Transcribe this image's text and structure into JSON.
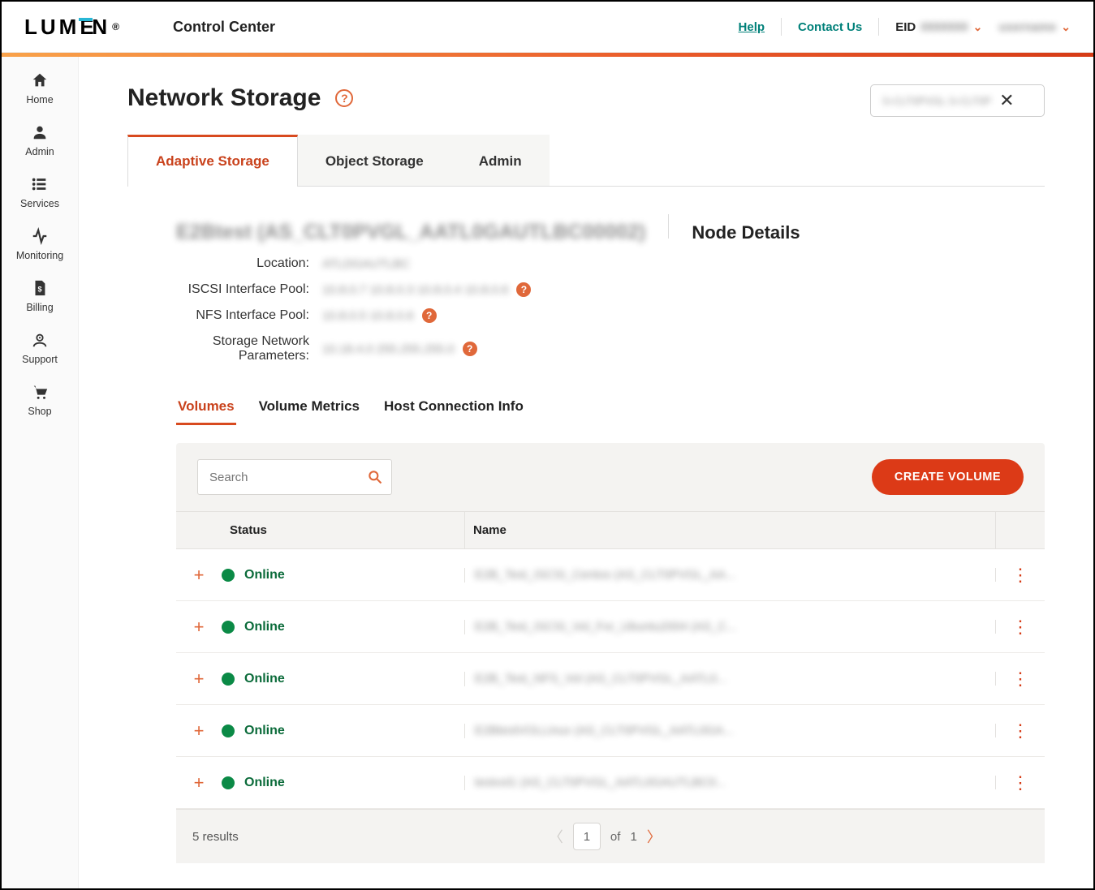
{
  "header": {
    "brand": "LUMEN",
    "app": "Control Center",
    "help": "Help",
    "contact": "Contact Us",
    "eid_label": "EID",
    "eid_value": "0000000",
    "user": "username"
  },
  "sidebar": {
    "items": [
      {
        "label": "Home"
      },
      {
        "label": "Admin"
      },
      {
        "label": "Services"
      },
      {
        "label": "Monitoring"
      },
      {
        "label": "Billing"
      },
      {
        "label": "Support"
      },
      {
        "label": "Shop"
      }
    ]
  },
  "page": {
    "title": "Network Storage",
    "chip_value": "S-CLT0PVGL S-CLT0P",
    "tabs": [
      {
        "label": "Adaptive Storage",
        "active": true
      },
      {
        "label": "Object Storage",
        "active": false
      },
      {
        "label": "Admin",
        "active": false
      }
    ]
  },
  "node": {
    "heading": "E2Btest (AS_CLT0PVGL_AATL0GAUTLBC00002)",
    "title": "Node Details",
    "rows": [
      {
        "label": "Location:",
        "value": "ATLDGAUTLBC",
        "help": false
      },
      {
        "label": "ISCSI Interface Pool:",
        "value": "10.8.0.7 10.8.0.3 10.8.0.4 10.8.0.6",
        "help": true
      },
      {
        "label": "NFS Interface Pool:",
        "value": "10.8.0.5 10.8.0.6",
        "help": true
      },
      {
        "label": "Storage Network Parameters:",
        "value": "10.18.4.0 255.255.255.0",
        "help": true
      }
    ]
  },
  "subtabs": [
    {
      "label": "Volumes",
      "active": true
    },
    {
      "label": "Volume Metrics",
      "active": false
    },
    {
      "label": "Host Connection Info",
      "active": false
    }
  ],
  "table": {
    "search_placeholder": "Search",
    "create": "CREATE VOLUME",
    "columns": {
      "status": "Status",
      "name": "Name"
    },
    "rows": [
      {
        "status": "Online",
        "name": "E2B_Test_ISCSI_Centos (AS_CLT0PVGL_AA..."
      },
      {
        "status": "Online",
        "name": "E2B_Test_ISCSI_Vol_For_Ubuntu2004 (AS_C..."
      },
      {
        "status": "Online",
        "name": "E2B_Test_NFS_Vol (AS_CLT0PVGL_AATL0..."
      },
      {
        "status": "Online",
        "name": "E2BtestVOLLinux (AS_CLT0PVGL_AATL0GA..."
      },
      {
        "status": "Online",
        "name": "testvol1 (AS_CLT0PVGL_AATL0GAUTLBC0..."
      }
    ],
    "results": "5 results",
    "page": "1",
    "of": "of",
    "total": "1"
  }
}
